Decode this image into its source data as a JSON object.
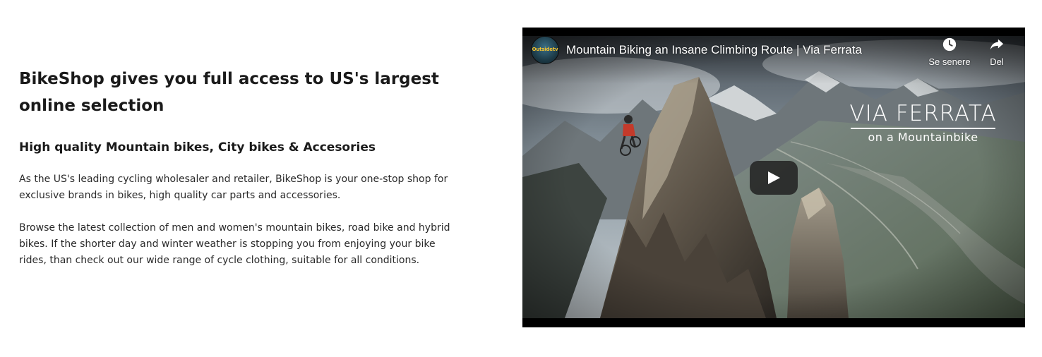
{
  "content": {
    "headline": "BikeShop gives you full access to US's largest online selection",
    "subheadline": "High quality Mountain bikes, City bikes & Accesories",
    "paragraph_1": "As the US's leading cycling wholesaler and retailer, BikeShop is your one-stop shop for exclusive brands in bikes, high quality car parts and accessories.",
    "paragraph_2": "Browse the latest collection of men and women's mountain bikes, road bike and hybrid bikes. If the shorter day and winter weather is stopping you from enjoying your bike rides, than check out our wide range of cycle clothing, suitable for all conditions."
  },
  "video": {
    "title": "Mountain Biking an Insane Climbing Route | Via Ferrata",
    "channel_avatar_text": "Outsidetv",
    "watch_later_label": "Se senere",
    "watch_later_icon": "clock-icon",
    "share_label": "Del",
    "share_icon": "share-arrow-icon",
    "overlay_title": "VIA FERRATA",
    "overlay_subtitle": "on a Mountainbike",
    "play_icon": "play-icon",
    "play_button_color": "#212121"
  }
}
